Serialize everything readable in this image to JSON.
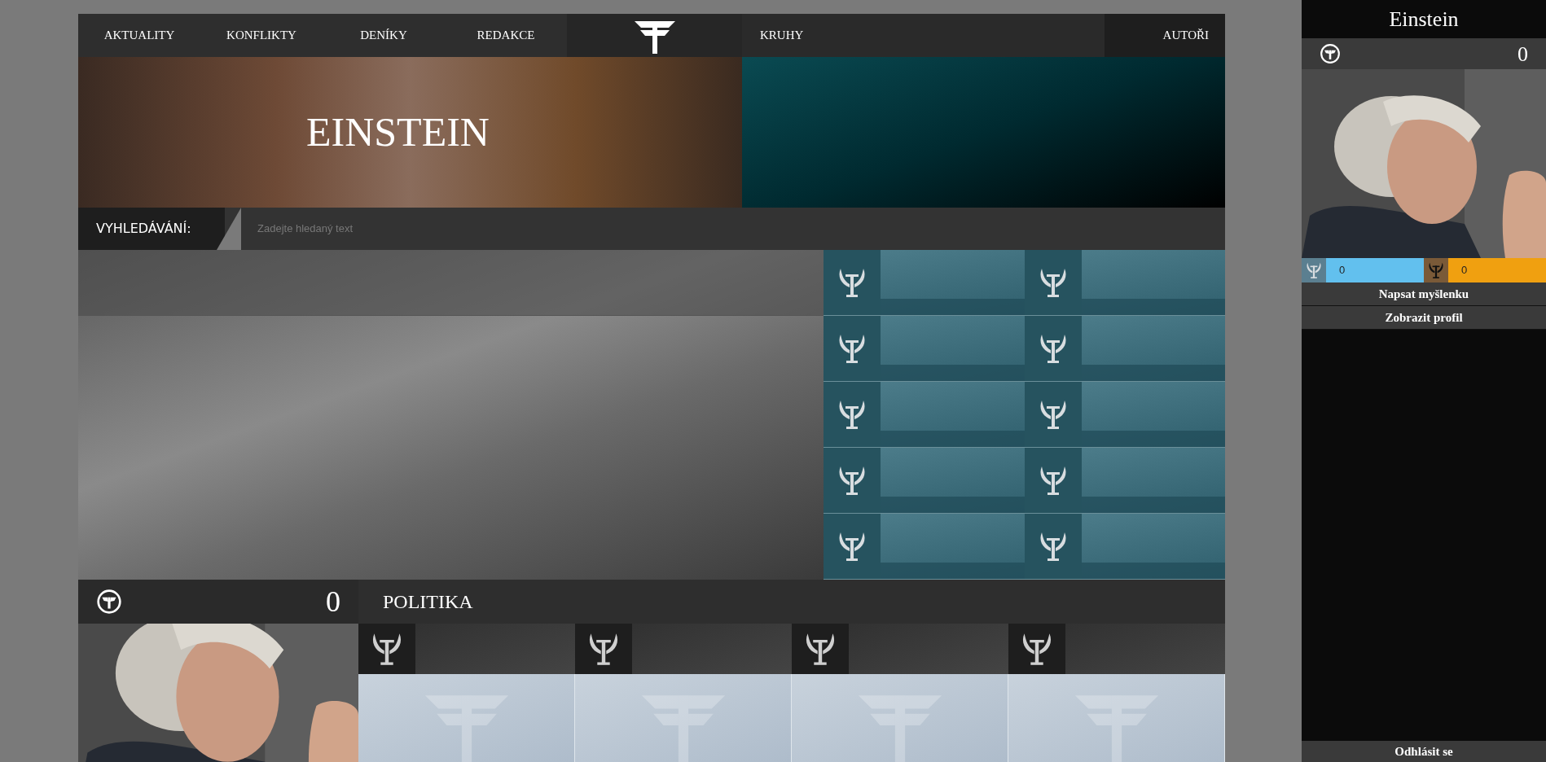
{
  "nav": {
    "left": [
      "AKTUALITY",
      "KONFLIKTY",
      "DENÍKY",
      "REDAKCE"
    ],
    "right": [
      "KRUHY"
    ],
    "end": "AUTOŘI"
  },
  "banner": {
    "title": "EINSTEIN"
  },
  "search": {
    "label": "VYHLEDÁVÁNÍ:",
    "placeholder": "Zadejte hledaný text"
  },
  "profile_card": {
    "score": "0"
  },
  "section": {
    "title": "POLITIKA"
  },
  "sidebar": {
    "name": "Einstein",
    "score": "0",
    "stats": [
      "0",
      "0"
    ],
    "actions": [
      "Napsat myšlenku",
      "Zobrazit profil"
    ],
    "logout": "Odhlásit se"
  }
}
